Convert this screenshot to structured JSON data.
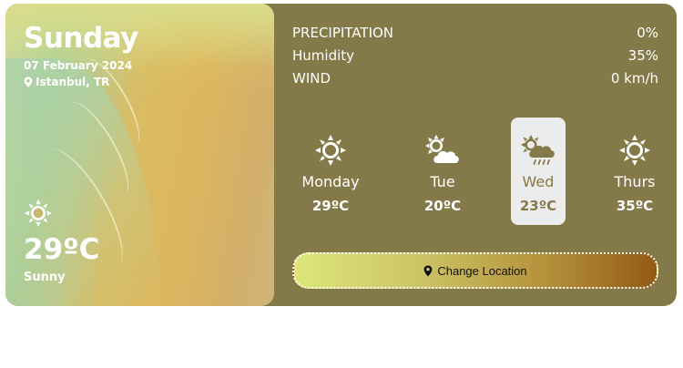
{
  "current": {
    "day": "Sunday",
    "date": "07 February 2024",
    "location": "Istanbul, TR",
    "temperature": "29ºC",
    "condition": "Sunny",
    "icon": "sun-icon"
  },
  "stats": [
    {
      "label": "PRECIPITATION",
      "value": "0%"
    },
    {
      "label": "Humidity",
      "value": "35%"
    },
    {
      "label": "WIND",
      "value": "0 km/h"
    }
  ],
  "forecast": [
    {
      "day": "Monday",
      "temp": "29ºC",
      "icon": "sun-icon",
      "active": false
    },
    {
      "day": "Tue",
      "temp": "20ºC",
      "icon": "partly-cloudy-icon",
      "active": false
    },
    {
      "day": "Wed",
      "temp": "23ºC",
      "icon": "sun-cloud-rain-icon",
      "active": true
    },
    {
      "day": "Thurs",
      "temp": "35ºC",
      "icon": "sun-icon",
      "active": false
    }
  ],
  "change_location": {
    "label": "Change Location",
    "icon": "map-pin-icon"
  },
  "colors": {
    "card": "#847a49",
    "active_tile": "#ececec",
    "active_text": "#847a49"
  }
}
